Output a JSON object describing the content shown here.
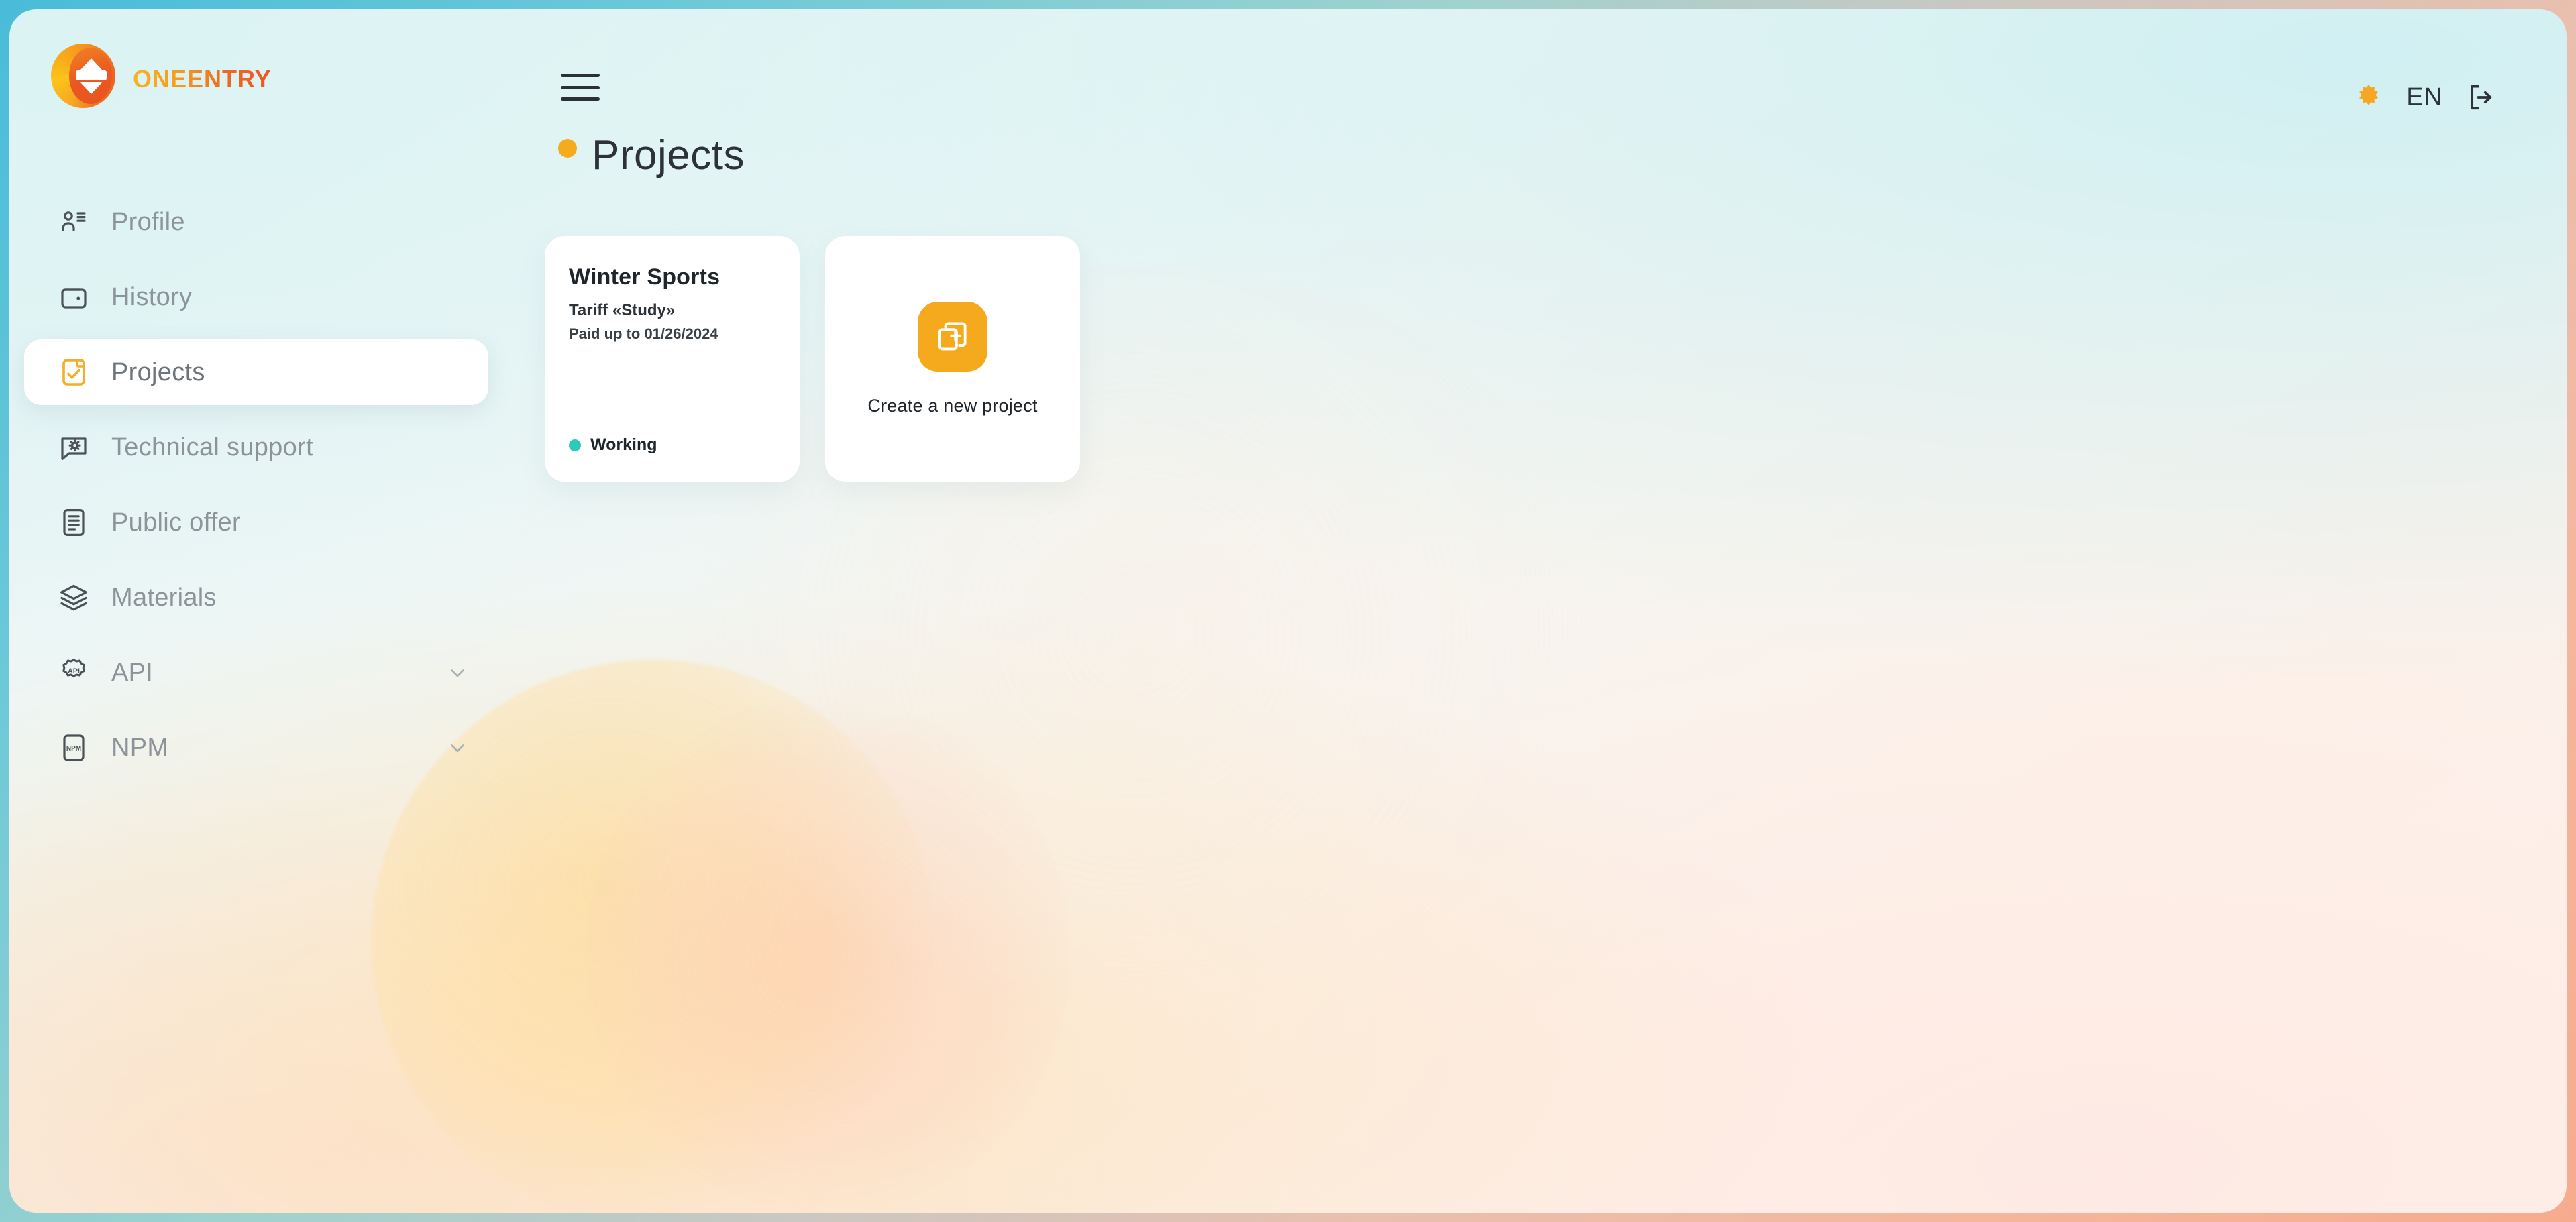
{
  "brand": {
    "name": "oneentry",
    "logo_icon": "oneentry-logo-icon"
  },
  "topbar": {
    "menu_icon": "hamburger-menu-icon",
    "theme_icon": "sun-icon",
    "language": "EN",
    "logout_icon": "logout-icon"
  },
  "sidebar": {
    "items": [
      {
        "label": "Profile",
        "icon": "user-contact-icon",
        "active": false,
        "expandable": false
      },
      {
        "label": "History",
        "icon": "wallet-icon",
        "active": false,
        "expandable": false
      },
      {
        "label": "Projects",
        "icon": "clipboard-check-icon",
        "active": true,
        "expandable": false
      },
      {
        "label": "Technical support",
        "icon": "chat-gear-icon",
        "active": false,
        "expandable": false
      },
      {
        "label": "Public offer",
        "icon": "document-lines-icon",
        "active": false,
        "expandable": false
      },
      {
        "label": "Materials",
        "icon": "layers-icon",
        "active": false,
        "expandable": false
      },
      {
        "label": "API",
        "icon": "gear-api-icon",
        "active": false,
        "expandable": true
      },
      {
        "label": "NPM",
        "icon": "npm-box-icon",
        "active": false,
        "expandable": true
      }
    ]
  },
  "main": {
    "title": "Projects",
    "title_dot_color": "#f5ab1e",
    "projects": [
      {
        "name": "Winter Sports",
        "tariff": "Tariff «Study»",
        "paid_until": "Paid up to 01/26/2024",
        "status": "Working",
        "status_color": "#2ec9ba"
      }
    ],
    "create_card": {
      "label": "Create a new project",
      "icon": "add-copy-icon",
      "button_color": "#f5a91d"
    }
  },
  "theme": {
    "accent": "#f5a623",
    "accent_deep": "#ec5623",
    "frame_start": "#49bcd9",
    "frame_end": "#f7ab8e"
  }
}
